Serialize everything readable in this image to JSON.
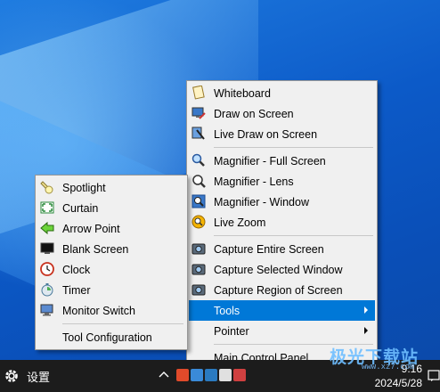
{
  "main_menu": {
    "items": [
      {
        "label": "Whiteboard",
        "icon": "whiteboard-icon"
      },
      {
        "label": "Draw on Screen",
        "icon": "draw-screen-icon"
      },
      {
        "label": "Live Draw on Screen",
        "icon": "live-draw-icon"
      },
      {
        "label": "Magnifier -  Full Screen",
        "icon": "magnifier-full-icon"
      },
      {
        "label": "Magnifier - Lens",
        "icon": "magnifier-lens-icon"
      },
      {
        "label": "Magnifier - Window",
        "icon": "magnifier-window-icon"
      },
      {
        "label": "Live Zoom",
        "icon": "live-zoom-icon"
      },
      {
        "label": "Capture Entire Screen",
        "icon": "camera-icon"
      },
      {
        "label": "Capture Selected Window",
        "icon": "camera-icon"
      },
      {
        "label": "Capture Region of Screen",
        "icon": "camera-icon"
      },
      {
        "label": "Tools",
        "submenu": true,
        "active": true
      },
      {
        "label": "Pointer",
        "submenu": true
      },
      {
        "label": "Main Control Panel"
      }
    ]
  },
  "tools_menu": {
    "items": [
      {
        "label": "Spotlight",
        "icon": "spotlight-icon"
      },
      {
        "label": "Curtain",
        "icon": "curtain-icon"
      },
      {
        "label": "Arrow Point",
        "icon": "arrow-point-icon"
      },
      {
        "label": "Blank Screen",
        "icon": "blank-screen-icon"
      },
      {
        "label": "Clock",
        "icon": "clock-icon"
      },
      {
        "label": "Timer",
        "icon": "timer-icon"
      },
      {
        "label": "Monitor Switch",
        "icon": "monitor-switch-icon"
      },
      {
        "label": "Tool Configuration"
      }
    ]
  },
  "taskbar": {
    "settings_label": "设置",
    "time": "9:16",
    "date": "2024/5/28"
  },
  "watermark": {
    "text": "极光下载站",
    "sub": "www.xz7.com"
  },
  "colors": {
    "menu_bg": "#f0f0f0",
    "highlight": "#0078d7",
    "taskbar": "#1c1c1c"
  }
}
